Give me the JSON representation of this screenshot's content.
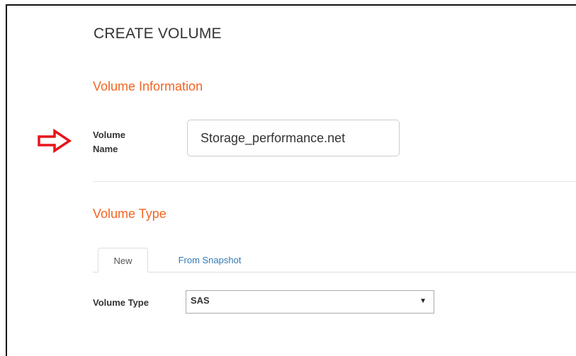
{
  "page": {
    "title": "CREATE VOLUME"
  },
  "volume_information": {
    "heading": "Volume Information",
    "name_label": "Volume Name",
    "name_value": "Storage_performance.net"
  },
  "volume_type": {
    "heading": "Volume Type",
    "tabs": [
      {
        "label": "New",
        "active": true
      },
      {
        "label": "From Snapshot",
        "active": false
      }
    ],
    "type_label": "Volume Type",
    "type_selected": "SAS"
  },
  "annotation": {
    "arrow_icon": "right-arrow-outline-icon",
    "arrow_color": "#e8141b"
  },
  "colors": {
    "section_heading": "#f26522",
    "link": "#337ab7"
  }
}
